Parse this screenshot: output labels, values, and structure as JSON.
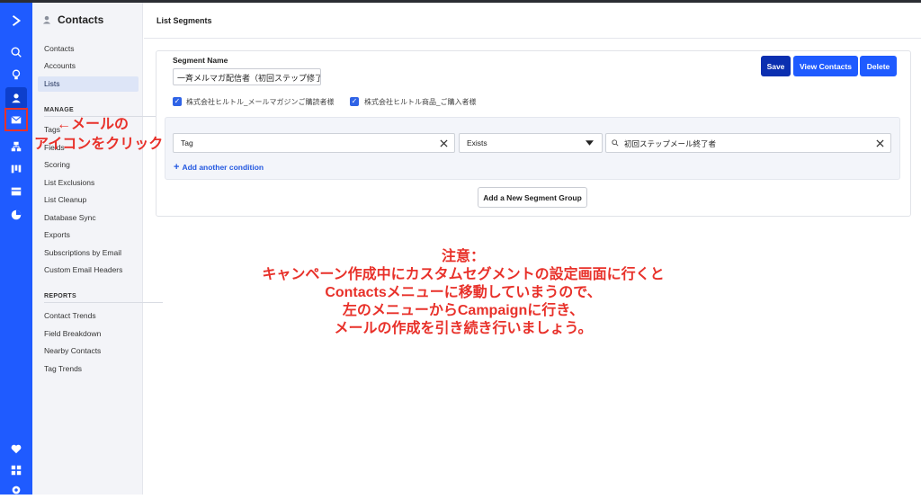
{
  "icon_rail": {
    "items": [
      {
        "icon": "logo-chevron-icon"
      },
      {
        "icon": "search-icon"
      },
      {
        "icon": "lightbulb-icon"
      },
      {
        "icon": "contacts-icon",
        "active": true
      },
      {
        "icon": "mail-icon",
        "highlighted": true
      },
      {
        "icon": "automation-icon"
      },
      {
        "icon": "pipeline-icon"
      },
      {
        "icon": "forms-icon"
      },
      {
        "icon": "reports-icon"
      },
      {
        "icon": "heart-icon"
      },
      {
        "icon": "apps-icon"
      },
      {
        "icon": "settings-icon"
      }
    ]
  },
  "subnav": {
    "title": "Contacts",
    "items": [
      "Contacts",
      "Accounts",
      "Lists"
    ],
    "active": "Lists",
    "manage_label": "MANAGE",
    "manage_items": [
      "Tags",
      "Fields",
      "Scoring",
      "List Exclusions",
      "List Cleanup",
      "Database Sync",
      "Exports",
      "Subscriptions by Email",
      "Custom Email Headers"
    ],
    "reports_label": "REPORTS",
    "reports_items": [
      "Contact Trends",
      "Field Breakdown",
      "Nearby Contacts",
      "Tag Trends"
    ]
  },
  "header": {
    "title": "List Segments"
  },
  "segment": {
    "name_label": "Segment Name",
    "name_value": "一斉メルマガ配信者（初回ステップ修了者",
    "lists": [
      "株式会社ヒルトル_メールマガジンご購読者様",
      "株式会社ヒルトル商品_ご購入者様"
    ]
  },
  "buttons": {
    "save": "Save",
    "view_contacts": "View Contacts",
    "delete": "Delete"
  },
  "condition": {
    "field": "Tag",
    "operator": "Exists",
    "value": "初回ステップメール終了者",
    "add_condition": "Add another condition"
  },
  "add_group": "Add a New Segment Group",
  "annotations": {
    "arrow_line1": "←メールの",
    "arrow_line2": "アイコンをクリック",
    "note_lines": [
      "注意：",
      "キャンペーン作成中にカスタムセグメントの設定画面に行くと",
      "Contactsメニューに移動していまうので、",
      "左のメニューからCampaignに行き、",
      "メールの作成を引き続き行いましょう。"
    ]
  },
  "colors": {
    "accent": "#1f5bff",
    "save": "#0b2fb0",
    "annotation": "#e8312a"
  }
}
